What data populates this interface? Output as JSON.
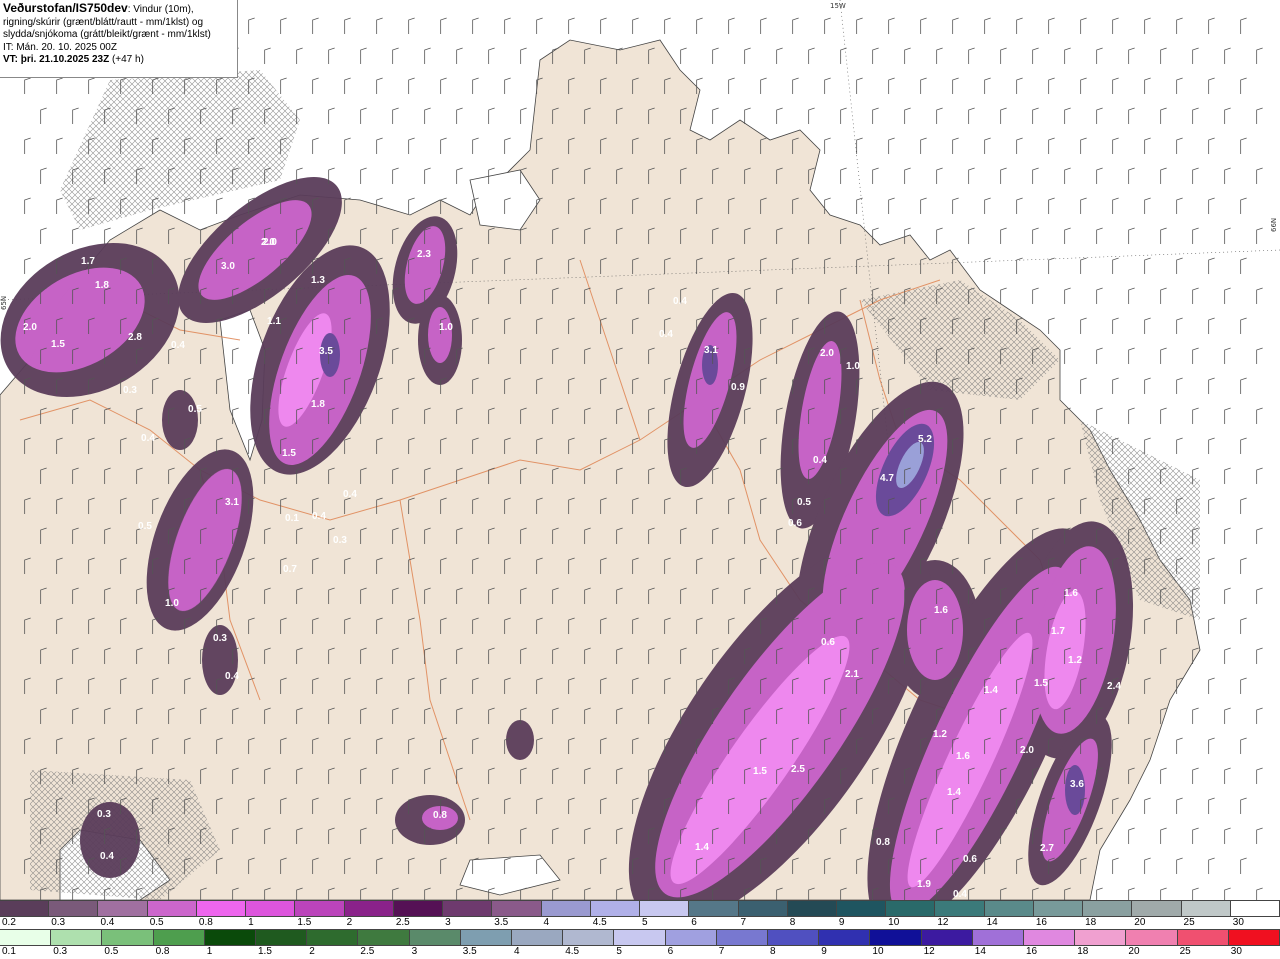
{
  "header": {
    "brand": "Veðurstofan/IS750dev",
    "description_1": ": Vindur (10m),",
    "description_2": "rigning/skúrir (grænt/blátt/rautt - mm/1klst) og",
    "description_3": "slydda/snjókoma (grátt/bleikt/grænt - mm/1klst)",
    "init_time": "IT: Mán. 20. 10. 2025 00Z",
    "valid_time": "VT: þri. 21.10.2025 23Z",
    "lead_time": "(+47 h)"
  },
  "graticule": {
    "lon_label": "15W",
    "lat_label": "66N",
    "lat_label_left": "65N"
  },
  "precip_values": [
    "2.0",
    "1.7",
    "1.8",
    "2.0",
    "1.5",
    "2.8",
    "0.4",
    "0.3",
    "0.5",
    "0.4",
    "3.0",
    "2.0",
    "1.3",
    "1.1",
    "3.5",
    "1.8",
    "1.5",
    "2.3",
    "1.0",
    "0.4",
    "3.1",
    "0.5",
    "1.0",
    "0.3",
    "0.4",
    "0.1",
    "0.4",
    "0.7",
    "0.3",
    "0.4",
    "0.4",
    "3.1",
    "0.9",
    "2.0",
    "1.0",
    "0.4",
    "0.5",
    "0.6",
    "5.2",
    "4.7",
    "1.6",
    "0.6",
    "2.1",
    "1.5",
    "2.5",
    "1.4",
    "1.6",
    "1.7",
    "1.2",
    "1.5",
    "2.4",
    "1.4",
    "1.2",
    "1.6",
    "2.0",
    "1.4",
    "3.6",
    "2.7",
    "0.3",
    "0.4",
    "0.8",
    "0.8",
    "0.6",
    "1.9",
    "0.4"
  ],
  "legend_snow": {
    "labels": [
      "0.2",
      "0.3",
      "0.4",
      "0.5",
      "0.8",
      "1",
      "1.5",
      "2",
      "2.5",
      "3",
      "3.5",
      "4",
      "4.5",
      "5",
      "6",
      "7",
      "8",
      "9",
      "10",
      "12",
      "14",
      "16",
      "18",
      "20",
      "25",
      "30"
    ],
    "colors": [
      "#5a3d5a",
      "#7a5a7a",
      "#a070a0",
      "#cc66cc",
      "#ee66ee",
      "#dd55dd",
      "#bb44bb",
      "#8a228a",
      "#551155",
      "#6e3a6e",
      "#8a5a8a",
      "#9a9ad0",
      "#b0b0e8",
      "#c8c8f0",
      "#557788",
      "#3b6070",
      "#244a55",
      "#1f5560",
      "#2a6a6a",
      "#3b7a7a",
      "#5a8a8a",
      "#789a9a",
      "#8aa0a0",
      "#a0aaaa",
      "#c0c8c8",
      "#ffffff"
    ]
  },
  "legend_rain": {
    "labels": [
      "0.1",
      "0.3",
      "0.5",
      "0.8",
      "1",
      "1.5",
      "2",
      "2.5",
      "3",
      "3.5",
      "4",
      "4.5",
      "5",
      "6",
      "7",
      "8",
      "9",
      "10",
      "12",
      "14",
      "16",
      "18",
      "20",
      "25",
      "30"
    ],
    "colors": [
      "#e8ffe8",
      "#aee0ae",
      "#7ac07a",
      "#4e9e4e",
      "#0a4a0a",
      "#1f5a1f",
      "#2e6b2e",
      "#3f7a3f",
      "#5a8a6a",
      "#7e9eb0",
      "#9aa8c0",
      "#b0b8d0",
      "#c8c8f0",
      "#a0a0e0",
      "#7878d0",
      "#5050c0",
      "#3030b0",
      "#101098",
      "#3c1aa0",
      "#a070d8",
      "#e088e0",
      "#f0a0d0",
      "#f080b0",
      "#f05070",
      "#f01020"
    ]
  }
}
